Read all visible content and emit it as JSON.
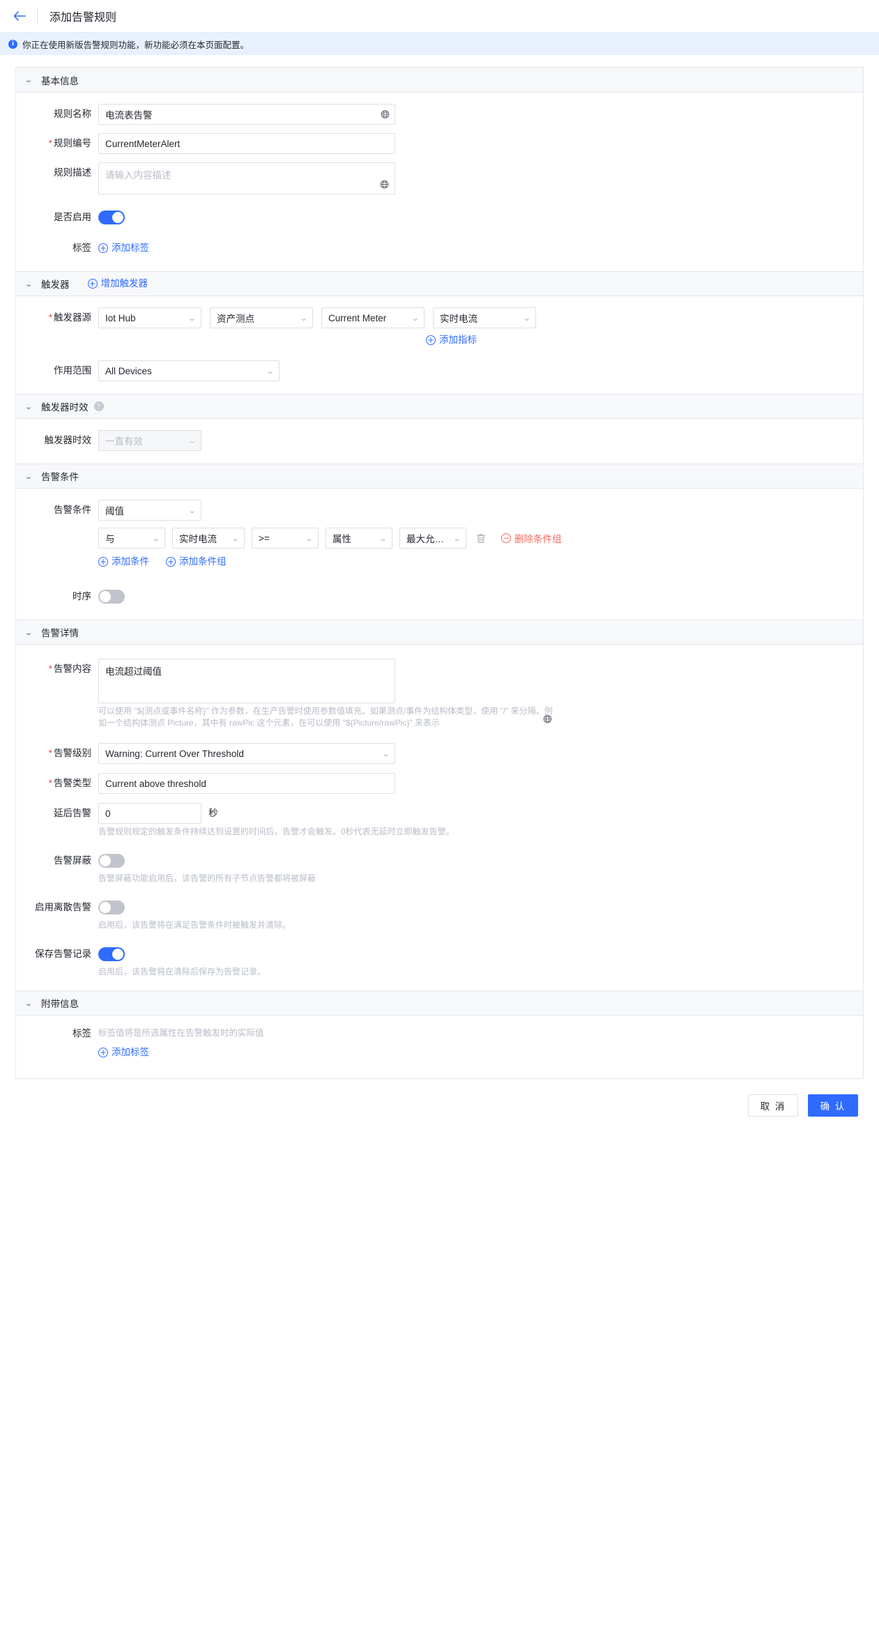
{
  "header": {
    "back_icon": "back-arrow-icon",
    "title": "添加告警规则"
  },
  "banner": {
    "icon": "info-icon",
    "text": "你正在使用新版告警规则功能，新功能必须在本页面配置。"
  },
  "basic_info": {
    "section_title": "基本信息",
    "rule_name": {
      "label": "规则名称",
      "value": "电流表告警",
      "required": false,
      "icon": "globe-icon"
    },
    "rule_code": {
      "label": "规则编号",
      "value": "CurrentMeterAlert",
      "required": true
    },
    "rule_desc": {
      "label": "规则描述",
      "value": "",
      "placeholder": "请输入内容描述",
      "required": false,
      "icon": "globe-icon"
    },
    "enabled": {
      "label": "是否启用",
      "on": true
    },
    "tags": {
      "label": "标签",
      "add_label": "添加标签"
    }
  },
  "trigger": {
    "section_title": "触发器",
    "add_trigger_label": "增加触发器",
    "source": {
      "label": "触发器源",
      "required": true,
      "selects": [
        "Iot Hub",
        "资产测点",
        "Current Meter",
        "实时电流"
      ]
    },
    "add_metric_label": "添加指标",
    "scope": {
      "label": "作用范围",
      "value": "All Devices"
    }
  },
  "trigger_validity": {
    "section_title": "触发器时效",
    "help_icon": "question-icon",
    "field": {
      "label": "触发器时效",
      "value": "一直有效",
      "disabled": true
    }
  },
  "alarm_condition": {
    "section_title": "告警条件",
    "condition_type": {
      "label": "告警条件",
      "value": "阈值"
    },
    "condition_row": {
      "logic": "与",
      "metric": "实时电流",
      "operator": ">=",
      "value_type": "属性",
      "value": "最大允许...",
      "delete_icon": "trash-icon",
      "delete_group_label": "删除条件组"
    },
    "add_condition_label": "添加条件",
    "add_condition_group_label": "添加条件组",
    "time_series": {
      "label": "时序",
      "on": false
    }
  },
  "alarm_detail": {
    "section_title": "告警详情",
    "content": {
      "label": "告警内容",
      "required": true,
      "value": "电流超过阈值",
      "icon": "globe-icon",
      "hint": "可以使用 \"${测点或事件名称}\" 作为参数，在生产告警时使用参数值填充。如果测点/事件为结构体类型，使用 \"/\" 来分隔。例如一个结构体测点 Picture，其中有 rawPic 这个元素，在可以使用 \"${Picture/rawPic}\" 来表示"
    },
    "level": {
      "label": "告警级别",
      "required": true,
      "value": "Warning: Current Over Threshold"
    },
    "type": {
      "label": "告警类型",
      "required": true,
      "value": "Current above threshold"
    },
    "delay": {
      "label": "延后告警",
      "value": "0",
      "unit": "秒",
      "hint": "告警规则规定的触发条件持续达到设置的时间后，告警才会触发。0秒代表无延时立即触发告警。"
    },
    "mask": {
      "label": "告警屏蔽",
      "on": false,
      "hint": "告警屏蔽功能启用后，该告警的所有子节点告警都将被屏蔽"
    },
    "discrete": {
      "label": "启用离散告警",
      "on": false,
      "hint": "启用后，该告警将在满足告警条件时被触发并清除。"
    },
    "save_record": {
      "label": "保存告警记录",
      "on": true,
      "hint": "启用后，该告警将在清除后保存为告警记录。"
    }
  },
  "extra_info": {
    "section_title": "附带信息",
    "tags": {
      "label": "标签",
      "hint": "标签值将是所选属性在告警触发时的实际值",
      "add_label": "添加标签"
    }
  },
  "footer": {
    "cancel_label": "取 消",
    "confirm_label": "确 认"
  },
  "colors": {
    "accent": "#2f6bff",
    "danger": "#f5685d",
    "required": "#e84c3d",
    "banner_bg": "#e8f1fd",
    "section_bg": "#f7f8fa"
  }
}
